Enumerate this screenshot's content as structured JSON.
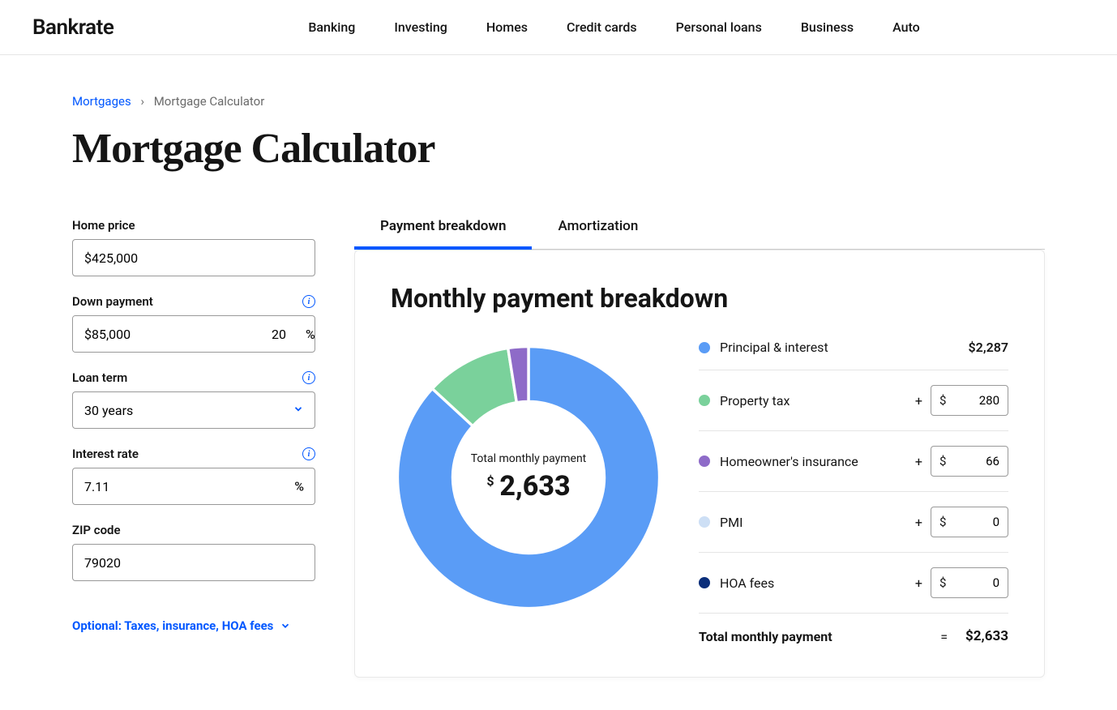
{
  "brand": "Bankrate",
  "nav": [
    "Banking",
    "Investing",
    "Homes",
    "Credit cards",
    "Personal loans",
    "Business",
    "Auto"
  ],
  "breadcrumb": {
    "link": "Mortgages",
    "sep": "›",
    "current": "Mortgage Calculator"
  },
  "page_title": "Mortgage Calculator",
  "form": {
    "home_price": {
      "label": "Home price",
      "value": "$425,000"
    },
    "down_payment": {
      "label": "Down payment",
      "value": "$85,000",
      "percent": "20",
      "unit": "%"
    },
    "loan_term": {
      "label": "Loan term",
      "value": "30 years"
    },
    "interest_rate": {
      "label": "Interest rate",
      "value": "7.11",
      "unit": "%"
    },
    "zip": {
      "label": "ZIP code",
      "value": "79020"
    },
    "optional_toggle": "Optional: Taxes, insurance, HOA fees"
  },
  "tabs": {
    "breakdown": "Payment breakdown",
    "amortization": "Amortization"
  },
  "card": {
    "title": "Monthly payment breakdown",
    "donut": {
      "label": "Total monthly payment",
      "value": "2,633",
      "currency": "$"
    },
    "rows": {
      "pi": {
        "name": "Principal & interest",
        "value": "$2,287",
        "color": "#5a9cf6"
      },
      "tax": {
        "name": "Property tax",
        "value": "280",
        "color": "#7ad19b",
        "currency": "$"
      },
      "ins": {
        "name": "Homeowner's insurance",
        "value": "66",
        "color": "#8e6bc8",
        "currency": "$"
      },
      "pmi": {
        "name": "PMI",
        "value": "0",
        "color": "#cddff5",
        "currency": "$"
      },
      "hoa": {
        "name": "HOA fees",
        "value": "0",
        "color": "#0b2e7a",
        "currency": "$"
      }
    },
    "plus": "+",
    "total": {
      "label": "Total monthly payment",
      "eq": "=",
      "value": "$2,633"
    }
  },
  "chart_data": {
    "type": "pie",
    "title": "Monthly payment breakdown",
    "series": [
      {
        "name": "Principal & interest",
        "value": 2287,
        "color": "#5a9cf6"
      },
      {
        "name": "Property tax",
        "value": 280,
        "color": "#7ad19b"
      },
      {
        "name": "Homeowner's insurance",
        "value": 66,
        "color": "#8e6bc8"
      },
      {
        "name": "PMI",
        "value": 0,
        "color": "#cddff5"
      },
      {
        "name": "HOA fees",
        "value": 0,
        "color": "#0b2e7a"
      }
    ],
    "total": 2633
  }
}
